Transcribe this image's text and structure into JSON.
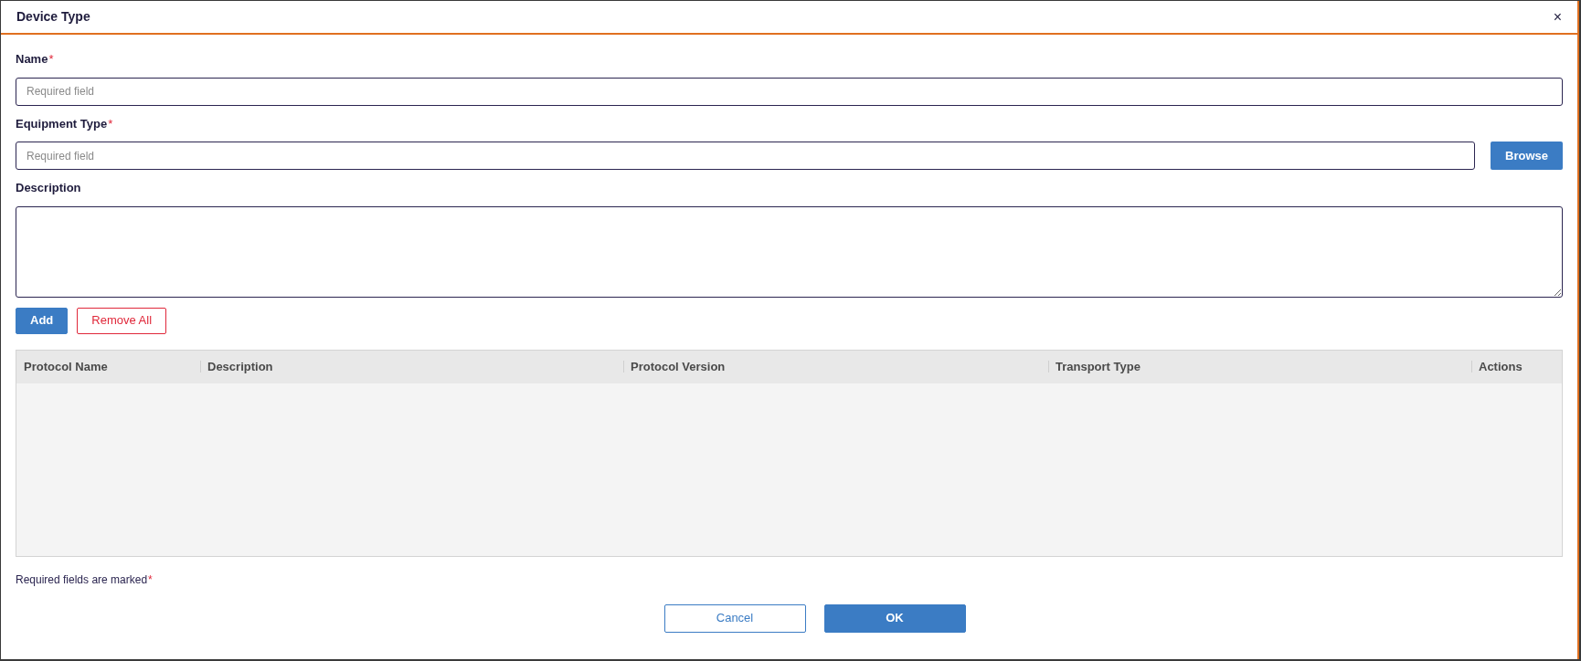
{
  "dialog": {
    "title": "Device Type",
    "close": "×"
  },
  "fields": [
    {
      "kind": "input",
      "label": "Name",
      "required_mark": "*",
      "placeholder": "Required field"
    },
    {
      "kind": "browse",
      "label": "Equipment Type",
      "required_mark": "*",
      "placeholder": "Required field",
      "button": "Browse"
    },
    {
      "kind": "textarea",
      "label": "Description"
    }
  ],
  "actions": [
    {
      "kind": "primary",
      "label": "Add"
    },
    {
      "kind": "danger",
      "label": "Remove All"
    }
  ],
  "table": {
    "columns": [
      "Protocol Name",
      "Description",
      "Protocol Version",
      "Transport Type",
      "Actions"
    ]
  },
  "footnote": {
    "text": "Required fields are marked",
    "mark": "*"
  },
  "buttons": [
    {
      "kind": "secondary",
      "label": "Cancel"
    },
    {
      "kind": "primary",
      "label": "OK"
    }
  ]
}
